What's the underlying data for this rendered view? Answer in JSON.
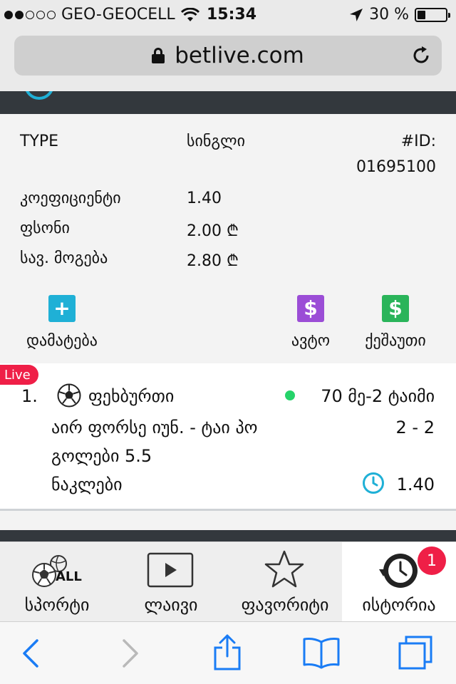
{
  "status": {
    "carrier": "GEO-GEOCELL",
    "time": "15:34",
    "battery": "30 %",
    "battery_level": 0.3
  },
  "browser": {
    "url": "betlive.com"
  },
  "bet": {
    "type_label": "TYPE",
    "type_value": "სინგლი",
    "id_label": "#ID:",
    "id_value": "01695100",
    "coefficient_label": "კოეფიციენტი",
    "coefficient_value": "1.40",
    "stake_label": "ფსონი",
    "stake_value": "2.00 ₾",
    "potential_label": "სავ. მოგება",
    "potential_value": "2.80 ₾",
    "actions": {
      "add": "დამატება",
      "auto": "ავტო",
      "cashout": "ქეშაუთი"
    }
  },
  "event": {
    "live_badge": "Live",
    "number": "1.",
    "sport": "ფეხბურთი",
    "minute": "70 მე-2 ტაიმი",
    "teams": "აირ ფორსე იუნ. - ტაი პო",
    "score": "2 - 2",
    "market": "გოლები 5.5",
    "selection": "ნაკლები",
    "odds": "1.40"
  },
  "nav": {
    "items": [
      {
        "label": "სპორტი",
        "icon_text": "ALL"
      },
      {
        "label": "ლაივი"
      },
      {
        "label": "ფავორიტი"
      },
      {
        "label": "ისტორია",
        "badge": "1"
      }
    ]
  },
  "colors": {
    "teal": "#1fb0d6",
    "purple": "#9b4dd6",
    "green": "#2ab45a",
    "live_red": "#ef1f47",
    "ios_blue": "#1a7cf5"
  }
}
